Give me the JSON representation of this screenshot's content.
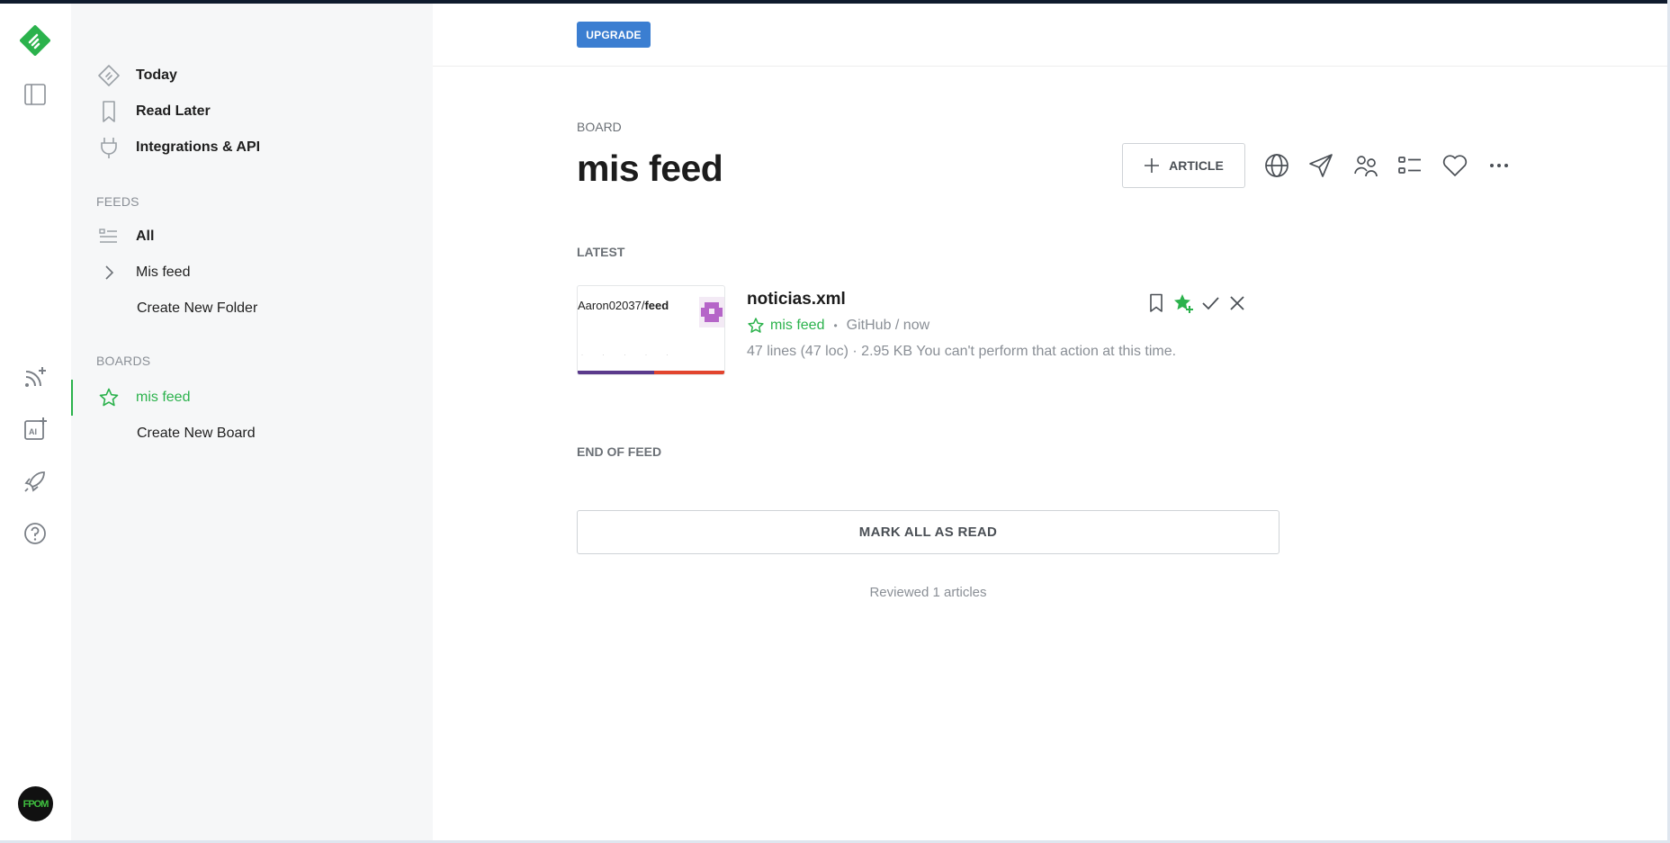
{
  "rail": {
    "icons": [
      "feedly-logo-icon",
      "sidebar-toggle-icon",
      "add-feed-icon",
      "ai-feed-icon",
      "rocket-icon",
      "help-icon",
      "avatar"
    ],
    "avatar_text": "FPOM"
  },
  "nav": {
    "top_items": [
      {
        "label": "Today",
        "icon": "today-icon"
      },
      {
        "label": "Read Later",
        "icon": "bookmark-icon"
      },
      {
        "label": "Integrations & API",
        "icon": "plug-icon"
      }
    ],
    "feeds_header": "FEEDS",
    "feeds": [
      {
        "label": "All",
        "icon": "list-icon"
      },
      {
        "label": "Mis feed",
        "icon": "chevron-right-icon"
      },
      {
        "label": "Create New Folder",
        "icon": ""
      }
    ],
    "boards_header": "BOARDS",
    "boards": [
      {
        "label": "mis feed",
        "icon": "star-icon",
        "active": true
      },
      {
        "label": "Create New Board",
        "icon": ""
      }
    ]
  },
  "topbar": {
    "upgrade_label": "UPGRADE"
  },
  "board": {
    "kind_label": "BOARD",
    "title": "mis feed",
    "article_button": "ARTICLE",
    "tools": [
      "globe-icon",
      "send-icon",
      "share-team-icon",
      "list-view-icon",
      "heart-icon",
      "more-icon"
    ]
  },
  "latest_label": "LATEST",
  "entry": {
    "thumb_prefix": "Aaron02037/",
    "thumb_bold": "feed",
    "title": "noticias.xml",
    "source": "mis feed",
    "meta_separator": "•",
    "origin": "GitHub / now",
    "summary": "47 lines (47 loc) · 2.95 KB You can't perform that action at this time.",
    "actions": [
      "bookmark-icon",
      "star-add-icon",
      "check-icon",
      "close-icon"
    ]
  },
  "end_label": "END OF FEED",
  "mark_all_label": "MARK ALL AS READ",
  "reviewed_text": "Reviewed 1 articles",
  "colors": {
    "accent": "#2bb24c",
    "upgrade": "#3b7ed1",
    "panel": "#f6f7f8"
  }
}
